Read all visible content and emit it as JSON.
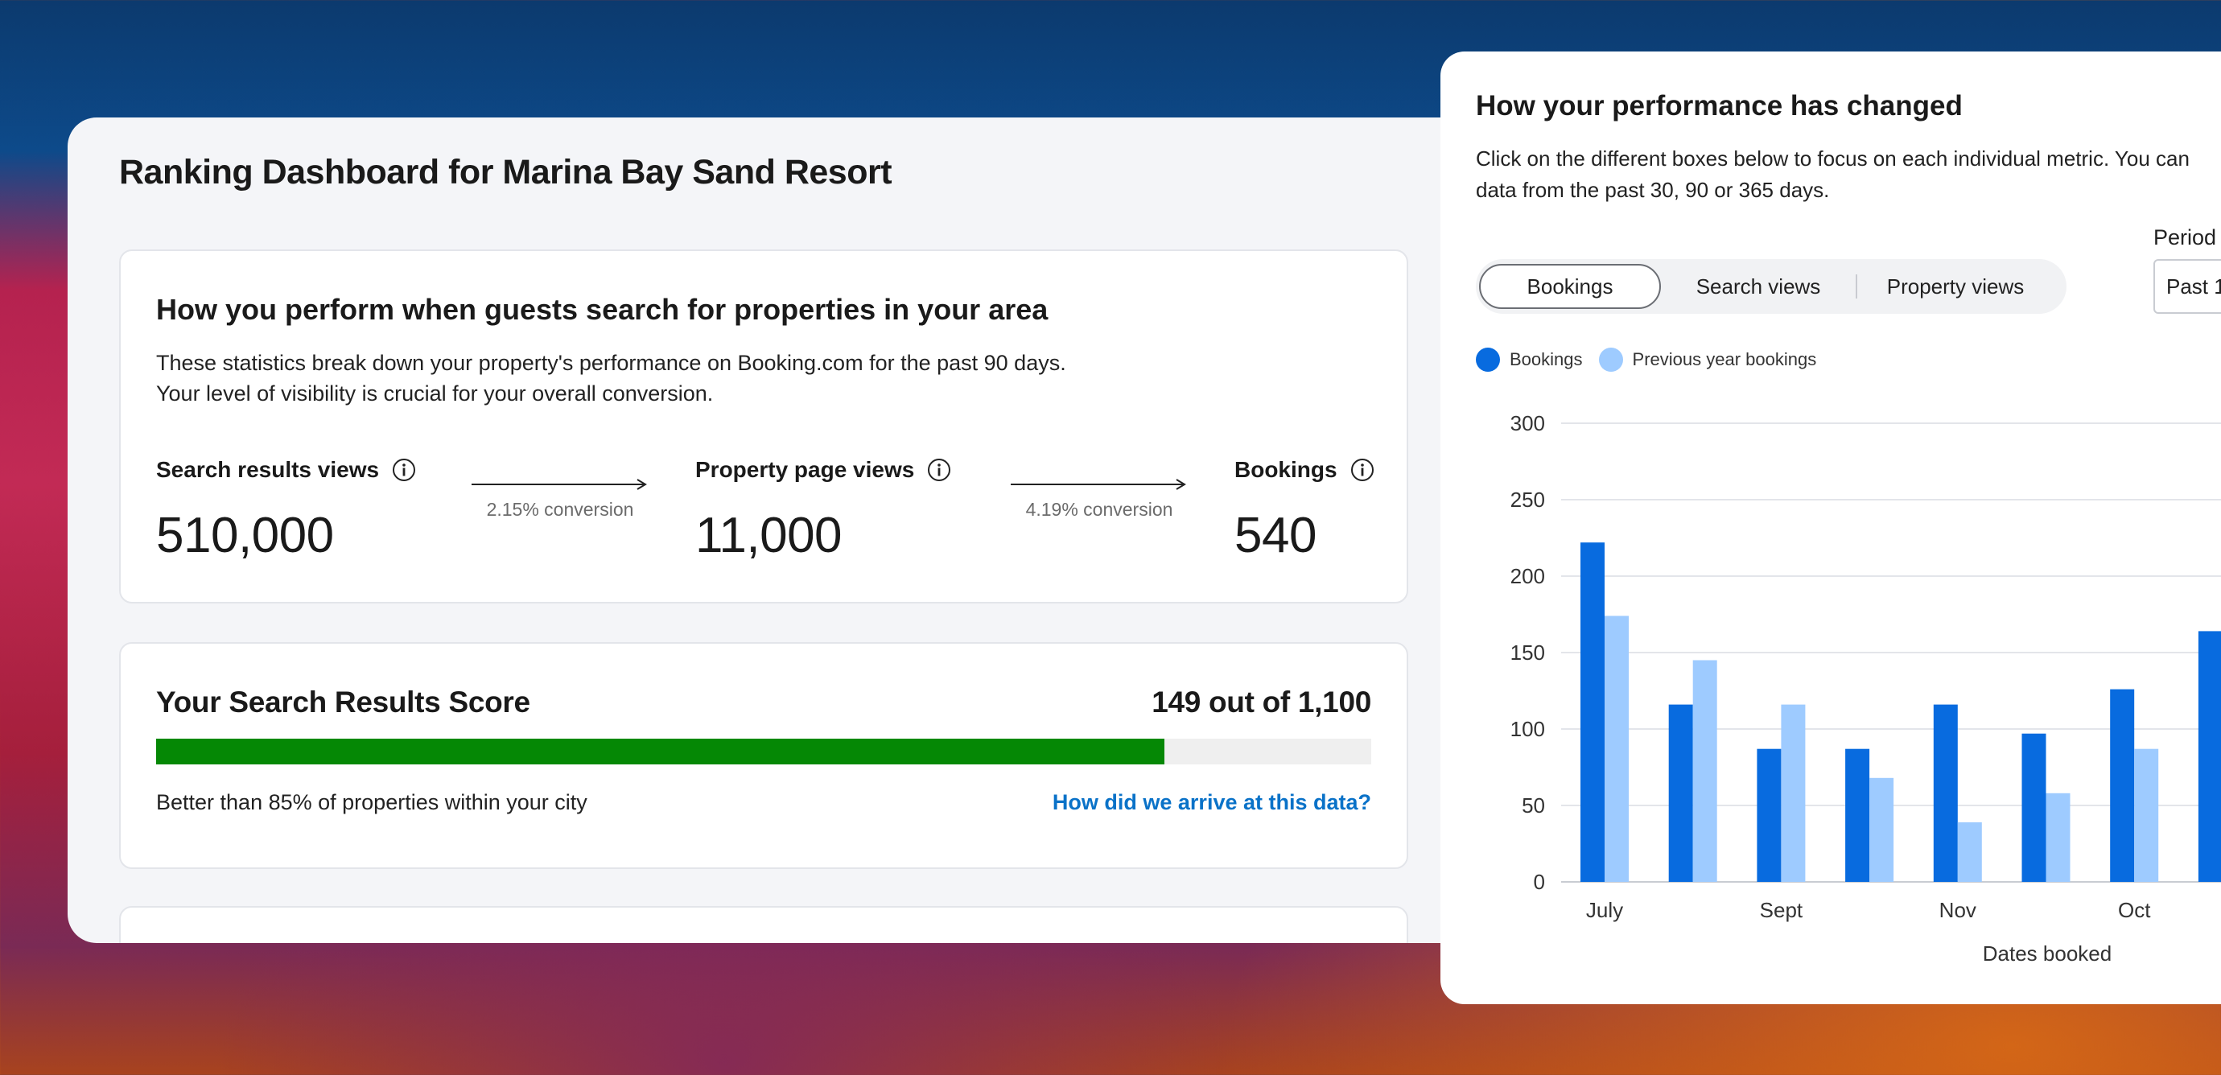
{
  "dashboard": {
    "title": "Ranking Dashboard for Marina Bay Sand Resort",
    "performance": {
      "heading": "How you perform when guests search for properties in your area",
      "description_line1": "These statistics break down your property's performance on Booking.com for the past 90 days.",
      "description_line2": "Your level of visibility is crucial for your overall conversion.",
      "metrics": [
        {
          "label": "Search results views",
          "value": "510,000"
        },
        {
          "label": "Property page views",
          "value": "11,000"
        },
        {
          "label": "Bookings",
          "value": "540"
        }
      ],
      "conversions": [
        "2.15% conversion",
        "4.19% conversion"
      ]
    },
    "score": {
      "title": "Your Search Results Score",
      "value": "149 out of 1,100",
      "progress_percent": 83,
      "caption": "Better than 85% of properties within your city",
      "link": "How did we arrive at this data?",
      "bar_color": "#058805"
    }
  },
  "changes_panel": {
    "title": "How your performance has changed",
    "description_line1": "Click on the different boxes below to focus on each individual metric. You can",
    "description_line2": "data from the past 30, 90 or 365 days.",
    "tabs": [
      "Bookings",
      "Search views",
      "Property views"
    ],
    "active_tab": "Bookings",
    "period_label": "Period",
    "period_value": "Past 1"
  },
  "chart_data": {
    "type": "bar",
    "categories": [
      "July",
      "",
      "Sept",
      "",
      "Nov",
      "",
      "Oct",
      ""
    ],
    "series": [
      {
        "name": "Bookings",
        "color": "#086bdf",
        "values": [
          222,
          116,
          87,
          87,
          116,
          97,
          126,
          164
        ]
      },
      {
        "name": "Previous year bookings",
        "color": "#9ecbff",
        "values": [
          174,
          145,
          116,
          68,
          39,
          58,
          87,
          null
        ]
      }
    ],
    "xlabel": "Dates booked",
    "ylabel": "",
    "ylim": [
      0,
      300
    ],
    "yticks": [
      0,
      50,
      100,
      150,
      200,
      250,
      300
    ],
    "grid": true,
    "legend": "top-left"
  }
}
